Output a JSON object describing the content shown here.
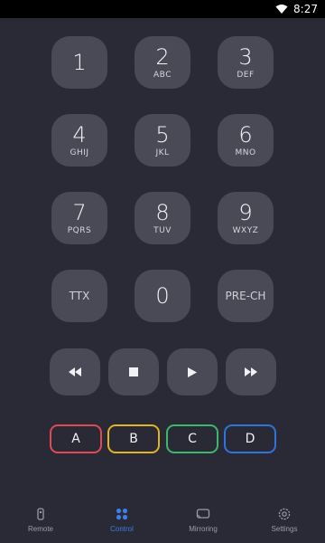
{
  "status": {
    "time": "8:27"
  },
  "keys": {
    "k1": {
      "digit": "1",
      "letters": ""
    },
    "k2": {
      "digit": "2",
      "letters": "ABC"
    },
    "k3": {
      "digit": "3",
      "letters": "DEF"
    },
    "k4": {
      "digit": "4",
      "letters": "GHIJ"
    },
    "k5": {
      "digit": "5",
      "letters": "JKL"
    },
    "k6": {
      "digit": "6",
      "letters": "MNO"
    },
    "k7": {
      "digit": "7",
      "letters": "PQRS"
    },
    "k8": {
      "digit": "8",
      "letters": "TUV"
    },
    "k9": {
      "digit": "9",
      "letters": "WXYZ"
    },
    "ttx": "TTX",
    "k0": "0",
    "prech": "PRE-CH"
  },
  "media": [
    "rewind-icon",
    "stop-icon",
    "play-icon",
    "fast-forward-icon"
  ],
  "color_keys": [
    {
      "label": "A",
      "color": "#e04a55"
    },
    {
      "label": "B",
      "color": "#e0b422"
    },
    {
      "label": "C",
      "color": "#3cb86a"
    },
    {
      "label": "D",
      "color": "#2f74dd"
    }
  ],
  "nav": {
    "remote": "Remote",
    "control": "Control",
    "mirroring": "Mirroring",
    "settings": "Settings",
    "active_color": "#3d7de8",
    "inactive_color": "#9d9ca7"
  }
}
